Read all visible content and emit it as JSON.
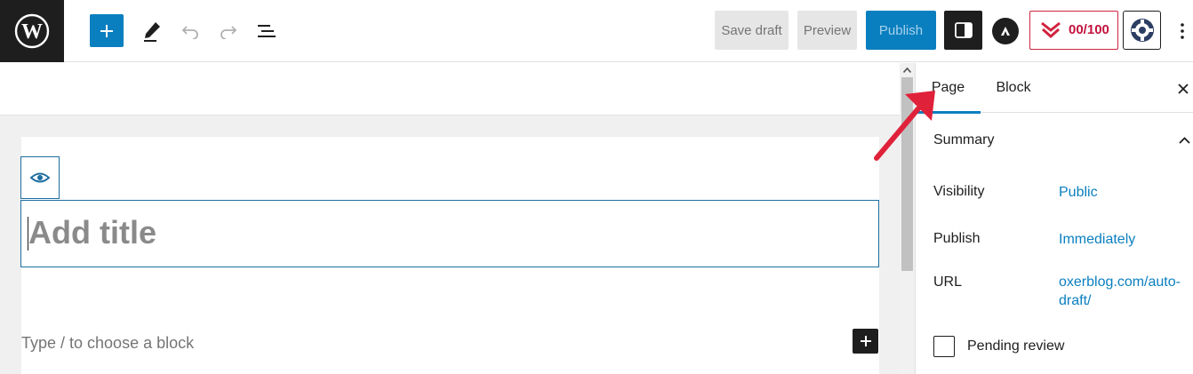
{
  "toolbar": {
    "save_draft_label": "Save draft",
    "preview_label": "Preview",
    "publish_label": "Publish",
    "score_label": "00/100",
    "icons": {
      "logo": "wordpress-logo",
      "add": "plus-icon",
      "tools": "pen-icon",
      "undo": "undo-icon",
      "redo": "redo-icon",
      "list_view": "list-view-icon",
      "settings": "sidebar-settings-icon",
      "astra": "astra-icon",
      "seo": "seo-score-icon",
      "gear": "gear-icon",
      "more": "more-vertical-icon"
    }
  },
  "editor": {
    "title_placeholder": "Add title",
    "block_hint": "Type / to choose a block"
  },
  "sidebar": {
    "tabs": [
      {
        "label": "Page",
        "active": true
      },
      {
        "label": "Block",
        "active": false
      }
    ],
    "summary_title": "Summary",
    "rows": [
      {
        "label": "Visibility",
        "value": "Public"
      },
      {
        "label": "Publish",
        "value": "Immediately"
      },
      {
        "label": "URL",
        "value": "oxerblog.com/auto-draft/"
      }
    ],
    "pending_review_label": "Pending review",
    "pending_review_checked": false
  },
  "colors": {
    "accent": "#0a7fbf",
    "annotation": "#e0213a",
    "seo": "#c3123d"
  }
}
